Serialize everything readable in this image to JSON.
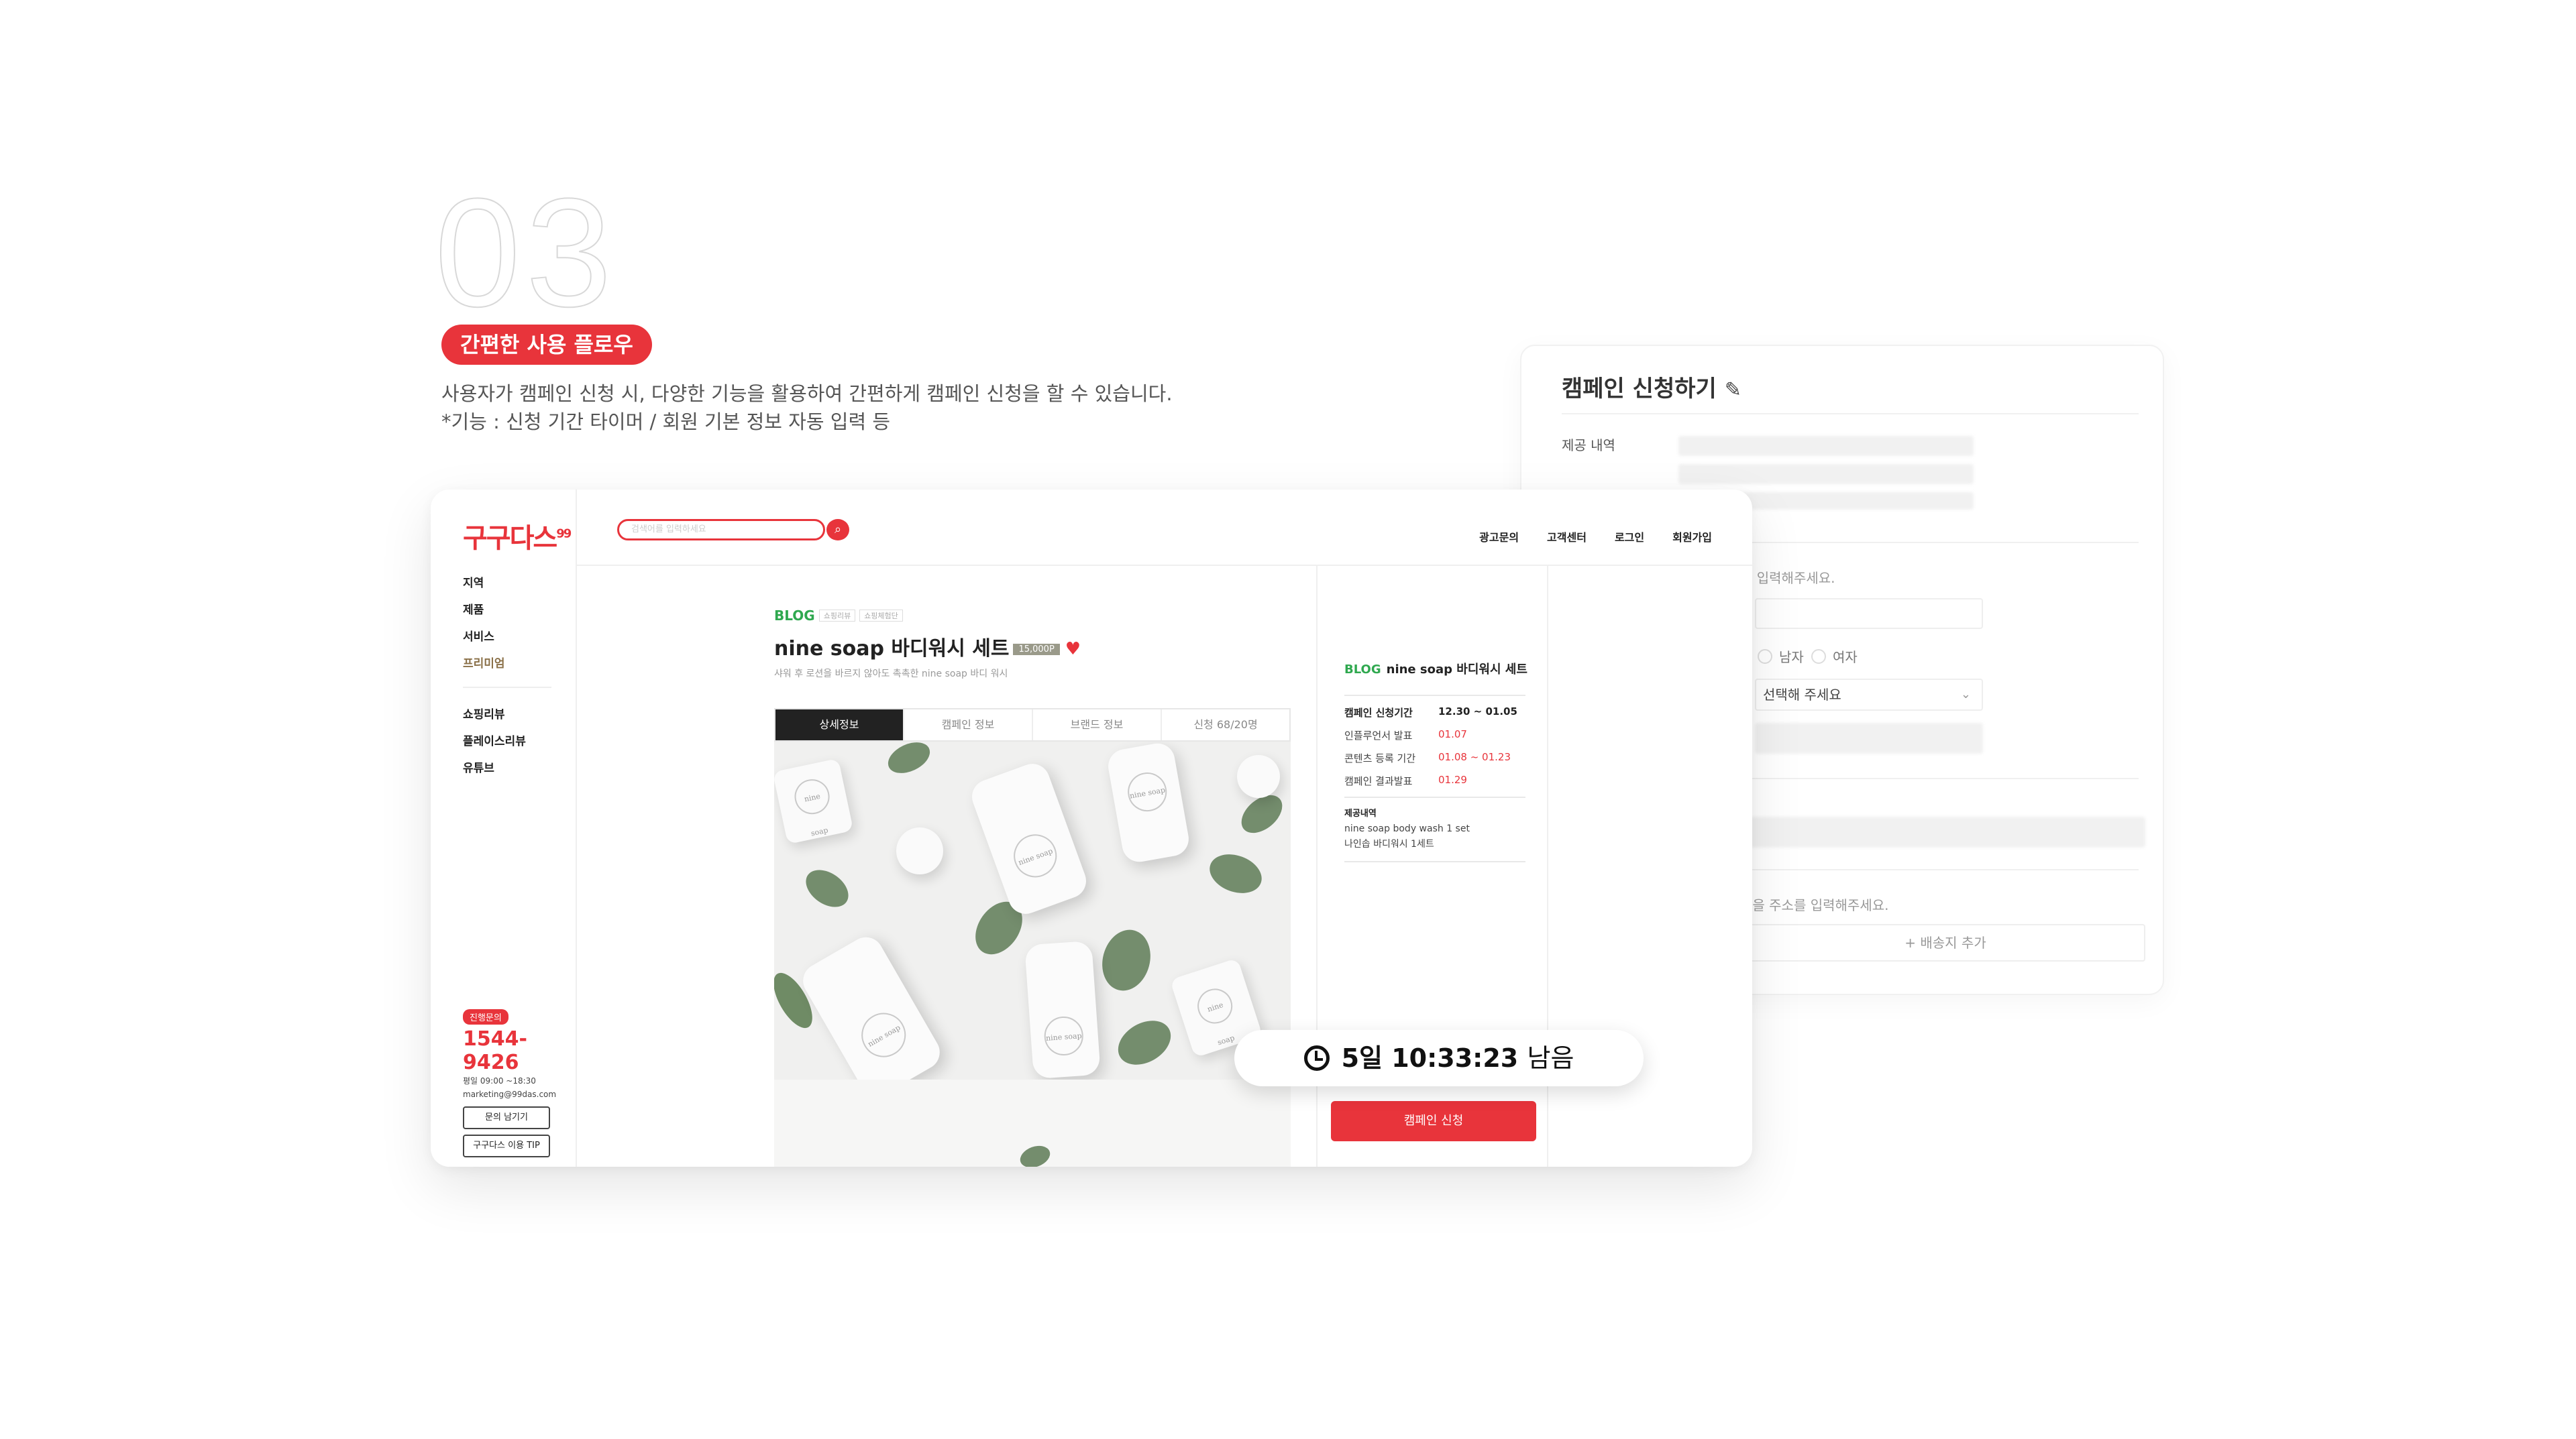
{
  "intro": {
    "step_number": "03",
    "pill": "간편한 사용 플로우",
    "desc_line1": "사용자가 캠페인 신청 시, 다양한 기능을 활용하여 간편하게 캠페인 신청을 할 수 있습니다.",
    "desc_line2": "*기능 : 신청 기간 타이머 / 회원 기본 정보 자동 입력 등"
  },
  "apply_form": {
    "title": "캠페인 신청하기",
    "provided_label": "제공 내역",
    "phone_hint": "를 입력해주세요.",
    "gender_male": "남자",
    "gender_female": "여자",
    "select_placeholder": "선택해 주세요",
    "address_hint": "문을 주소를 입력해주세요.",
    "add_address": "+ 배송지 추가"
  },
  "site": {
    "logo": "구구다스",
    "search_placeholder": "검색어를 입력하세요",
    "nav": [
      "광고문의",
      "고객센터",
      "로그인",
      "회원가입"
    ],
    "sidebar_menu": [
      "지역",
      "제품",
      "서비스",
      "프리미엄"
    ],
    "sidebar_menu2": [
      "쇼핑리뷰",
      "플레이스리뷰",
      "유튜브"
    ],
    "contact": {
      "badge": "진행문의",
      "phone": "1544-9426",
      "hours": "평일 09:00 ~18:30",
      "email": "marketing@99das.com",
      "btn_inquiry": "문의 남기기",
      "btn_tip": "구구다스 이용 TIP"
    }
  },
  "product": {
    "channel": "BLOG",
    "tag1": "쇼핑리뷰",
    "tag2": "쇼핑체험단",
    "title": "nine soap 바디워시 세트",
    "points": "15,000P",
    "subtitle": "샤워 후 로션을 바르지 않아도 촉촉한 nine soap 바디 워시",
    "tabs": [
      "상세정보",
      "캠페인 정보",
      "브랜드 정보",
      "신청 68/20명"
    ],
    "bottle_label": "nine soap"
  },
  "campaign": {
    "channel": "BLOG",
    "title": "nine soap 바디워시 세트",
    "rows": [
      {
        "label": "캠페인 신청기간",
        "value": "12.30 ~ 01.05"
      },
      {
        "label": "인플루언서 발표",
        "value": "01.07"
      },
      {
        "label": "콘텐츠 등록 기간",
        "value": "01.08 ~ 01.23"
      },
      {
        "label": "캠페인 결과발표",
        "value": "01.29"
      }
    ],
    "provided_label": "제공내역",
    "provided_line1": "nine soap body wash 1 set",
    "provided_line2": "나인솝 바디워시 1세트",
    "apply_button": "캠페인 신청"
  },
  "timer": {
    "time": "5일 10:33:23",
    "suffix": "남음"
  },
  "colors": {
    "accent": "#e8343b",
    "blog_green": "#2fa84f"
  }
}
